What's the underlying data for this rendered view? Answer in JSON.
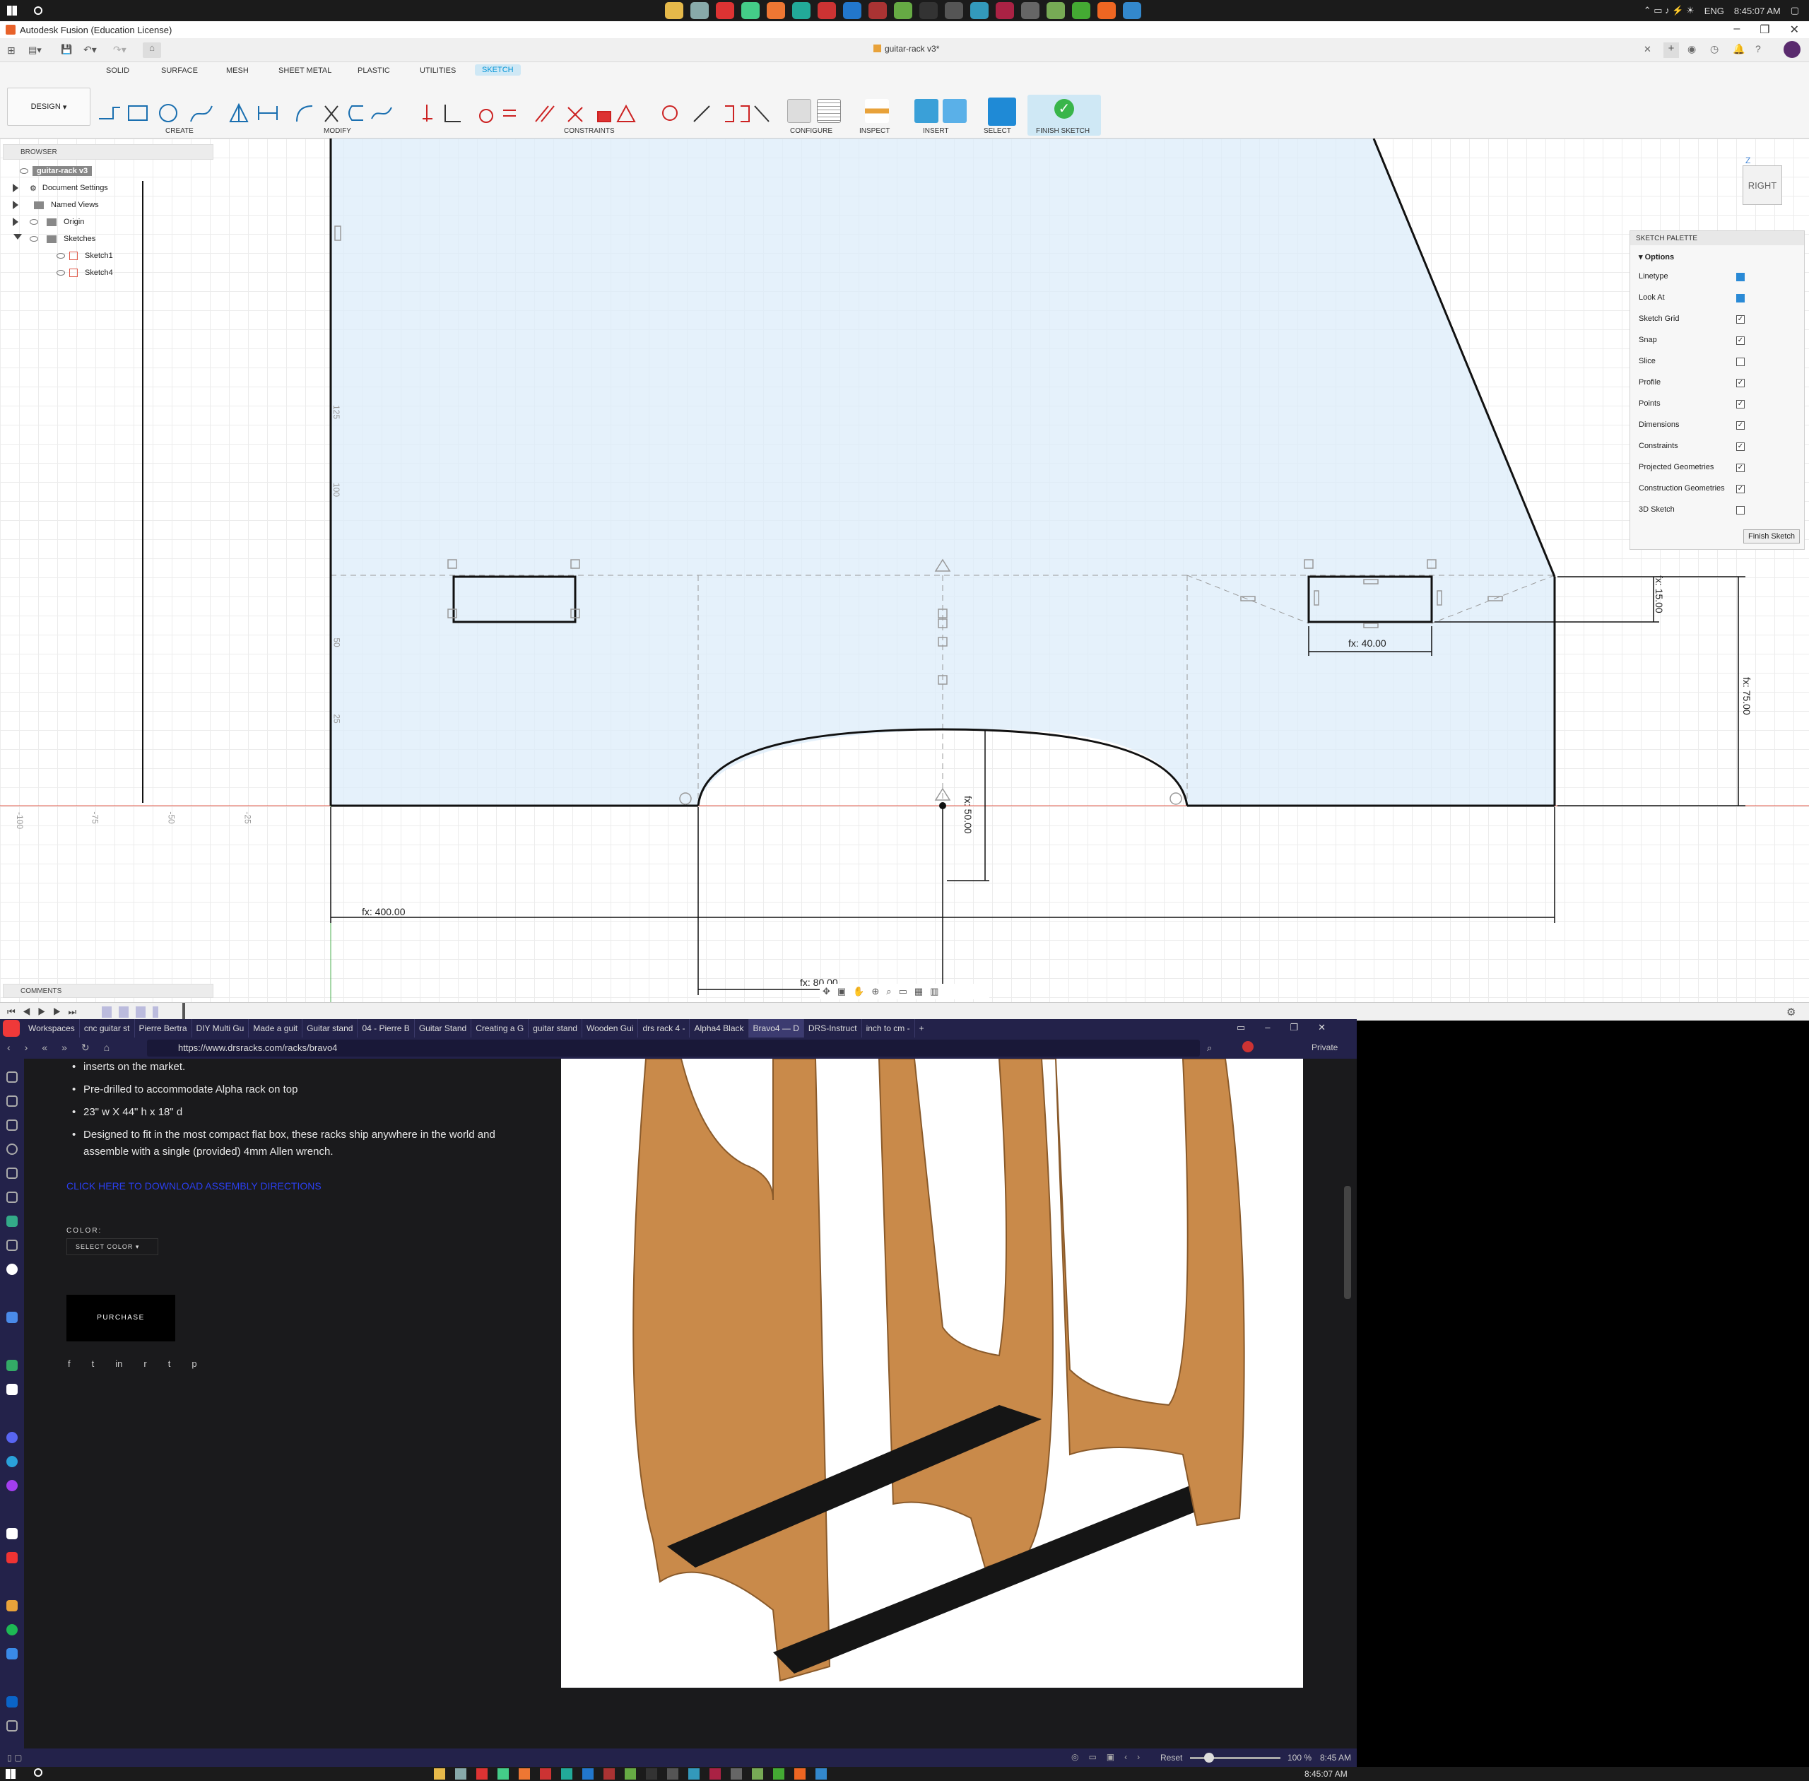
{
  "taskbar_top": {
    "clock": "8:45:07 AM",
    "lang": "ENG"
  },
  "fusion": {
    "title": "Autodesk Fusion (Education License)",
    "doc_tab": "guitar-rack v3*",
    "workspace": "DESIGN",
    "ribbon_tabs": [
      "SOLID",
      "SURFACE",
      "MESH",
      "SHEET METAL",
      "PLASTIC",
      "UTILITIES",
      "SKETCH"
    ],
    "groups": {
      "create": "CREATE",
      "modify": "MODIFY",
      "constraints": "CONSTRAINTS",
      "configure": "CONFIGURE",
      "inspect": "INSPECT",
      "insert": "INSERT",
      "select": "SELECT",
      "finish": "FINISH SKETCH"
    },
    "browser": {
      "title": "BROWSER",
      "root": "guitar-rack v3",
      "items": [
        "Document Settings",
        "Named Views",
        "Origin",
        "Sketches"
      ],
      "sketches": [
        "Sketch1",
        "Sketch4"
      ]
    },
    "viewcube": {
      "face": "RIGHT",
      "axis": "Z"
    },
    "palette": {
      "title": "SKETCH PALETTE",
      "section": "Options",
      "rows": [
        {
          "label": "Linetype",
          "checked": null
        },
        {
          "label": "Look At",
          "checked": null
        },
        {
          "label": "Sketch Grid",
          "checked": true
        },
        {
          "label": "Snap",
          "checked": true
        },
        {
          "label": "Slice",
          "checked": false
        },
        {
          "label": "Profile",
          "checked": true
        },
        {
          "label": "Points",
          "checked": true
        },
        {
          "label": "Dimensions",
          "checked": true
        },
        {
          "label": "Constraints",
          "checked": true
        },
        {
          "label": "Projected Geometries",
          "checked": true
        },
        {
          "label": "Construction Geometries",
          "checked": true
        },
        {
          "label": "3D Sketch",
          "checked": false
        }
      ],
      "finish": "Finish Sketch"
    },
    "dims": {
      "width": "fx: 400.00",
      "slot_w": "fx: 40.00",
      "slot_h": "fx: 15.00",
      "height": "fx: 75.00",
      "arc": "fx: 50.00",
      "half": "fx: 80.00"
    },
    "ruler": [
      "-100",
      "-75",
      "-50",
      "-25",
      "25",
      "50",
      "100",
      "125"
    ],
    "comments": "COMMENTS"
  },
  "vivaldi": {
    "workspaces": "Workspaces",
    "tabs": [
      "cnc guitar st",
      "Pierre Bertra",
      "DIY Multi Gu",
      "Made a guit",
      "Guitar stand",
      "04 - Pierre B",
      "Guitar Stand",
      "Creating a G",
      "guitar stand",
      "Wooden Gui",
      "drs rack 4 -",
      "Alpha4 Black",
      "Bravo4 — D",
      "DRS-Instruct",
      "inch to cm -"
    ],
    "url": "https://www.drsracks.com/racks/bravo4",
    "private": "Private",
    "bullets": [
      "inserts on the market.",
      "Pre-drilled to accommodate Alpha rack on top",
      "23\" w X 44\" h x 18\" d",
      "Designed to fit in the most compact flat box, these racks ship anywhere in the world and assemble with a single (provided) 4mm Allen wrench."
    ],
    "download_link": "CLICK HERE TO DOWNLOAD ASSEMBLY DIRECTIONS",
    "color_label": "COLOR:",
    "select_color": "SELECT COLOR",
    "purchase": "PURCHASE",
    "social": [
      "f",
      "t",
      "in",
      "r",
      "t",
      "p"
    ],
    "status": {
      "reset": "Reset",
      "zoom": "100 %",
      "time": "8:45 AM"
    }
  },
  "taskbar_bottom": {
    "clock": "8:45:07 AM"
  }
}
